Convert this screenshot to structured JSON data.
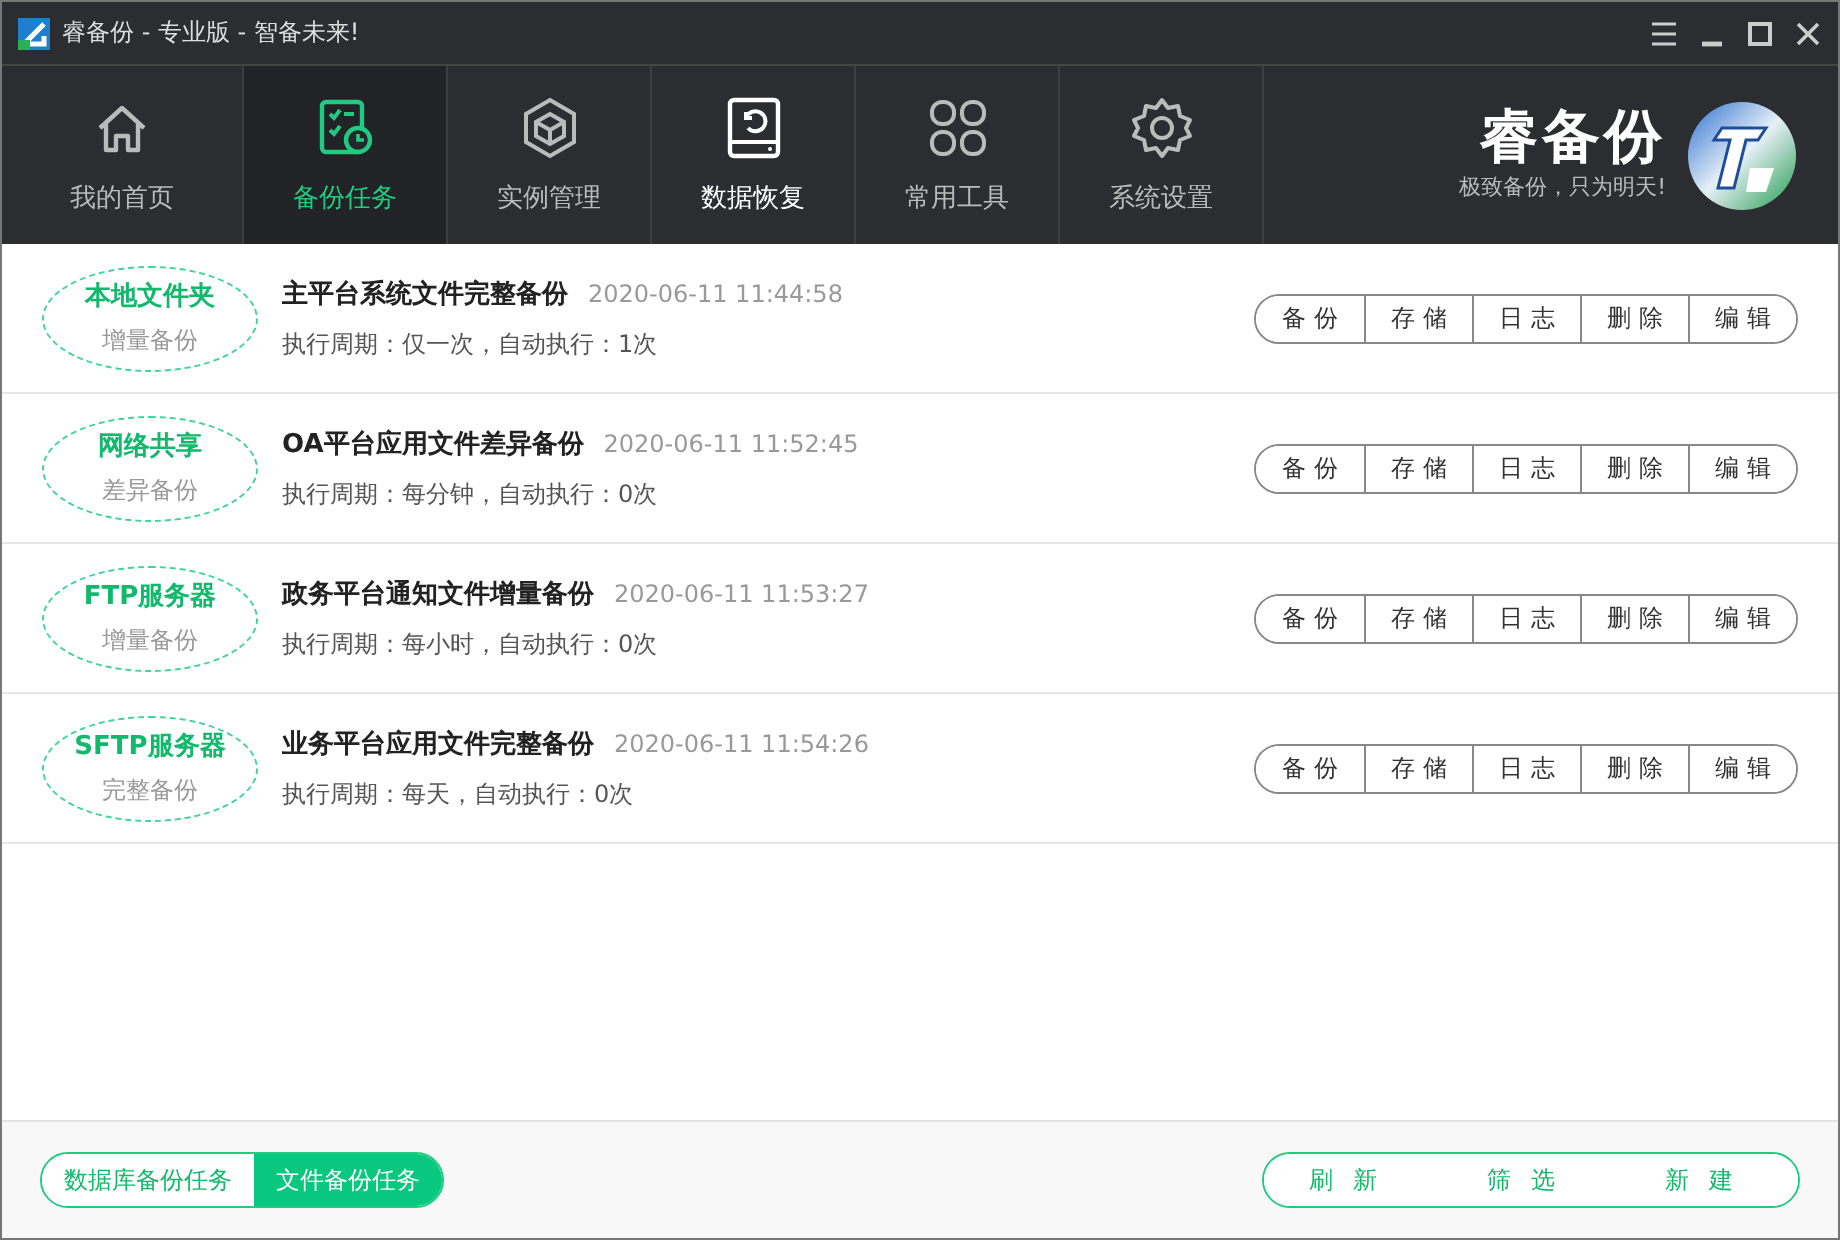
{
  "window": {
    "title": "睿备份 - 专业版 - 智备未来!"
  },
  "nav": [
    {
      "label": "我的首页",
      "selected": false,
      "hovered": false
    },
    {
      "label": "备份任务",
      "selected": true,
      "hovered": false
    },
    {
      "label": "实例管理",
      "selected": false,
      "hovered": false
    },
    {
      "label": "数据恢复",
      "selected": false,
      "hovered": true
    },
    {
      "label": "常用工具",
      "selected": false,
      "hovered": false
    },
    {
      "label": "系统设置",
      "selected": false,
      "hovered": false
    }
  ],
  "brand": {
    "name": "睿备份",
    "slogan": "极致备份，只为明天!"
  },
  "tasks": [
    {
      "source": "本地文件夹",
      "type": "增量备份",
      "name": "主平台系统文件完整备份",
      "time": "2020-06-11 11:44:58",
      "schedule": "执行周期：仅一次，自动执行：1次",
      "actions": [
        "备份",
        "存储",
        "日志",
        "删除",
        "编辑"
      ]
    },
    {
      "source": "网络共享",
      "type": "差异备份",
      "name": "OA平台应用文件差异备份",
      "time": "2020-06-11 11:52:45",
      "schedule": "执行周期：每分钟，自动执行：0次",
      "actions": [
        "备份",
        "存储",
        "日志",
        "删除",
        "编辑"
      ]
    },
    {
      "source": "FTP服务器",
      "type": "增量备份",
      "name": "政务平台通知文件增量备份",
      "time": "2020-06-11 11:53:27",
      "schedule": "执行周期：每小时，自动执行：0次",
      "actions": [
        "备份",
        "存储",
        "日志",
        "删除",
        "编辑"
      ]
    },
    {
      "source": "SFTP服务器",
      "type": "完整备份",
      "name": "业务平台应用文件完整备份",
      "time": "2020-06-11 11:54:26",
      "schedule": "执行周期：每天，自动执行：0次",
      "actions": [
        "备份",
        "存储",
        "日志",
        "删除",
        "编辑"
      ]
    }
  ],
  "footer": {
    "task_tabs": [
      {
        "label": "数据库备份任务",
        "selected": false
      },
      {
        "label": "文件备份任务",
        "selected": true
      }
    ],
    "buttons": [
      "刷新",
      "筛选",
      "新建"
    ]
  }
}
